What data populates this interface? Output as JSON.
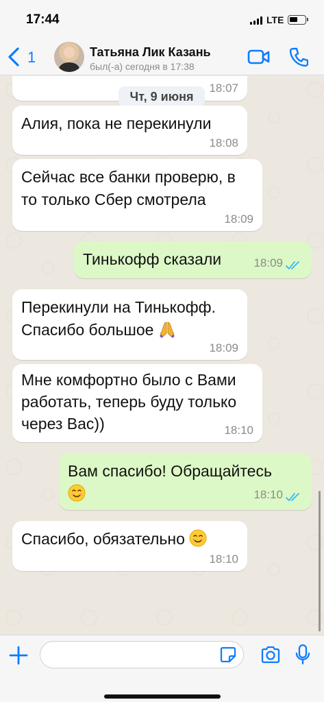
{
  "status_bar": {
    "time": "17:44",
    "network": "LTE"
  },
  "header": {
    "back_count": "1",
    "contact_name": "Татьяна Лик Казань",
    "contact_status": "был(-а) сегодня в 17:38",
    "icons": [
      "chevron-left-icon",
      "video-camera-icon",
      "phone-icon"
    ]
  },
  "chat": {
    "date_label": "Чт, 9 июня",
    "partial_time": "18:07",
    "messages": [
      {
        "direction": "in",
        "lines": [
          "Алия, пока не перекинули"
        ],
        "time": "18:08"
      },
      {
        "direction": "in",
        "lines": [
          "Сейчас все банки проверю, в",
          "то только Сбер смотрела"
        ],
        "time": "18:09"
      },
      {
        "direction": "out",
        "lines": [
          "Тинькофф сказали"
        ],
        "time": "18:09",
        "status": "read"
      },
      {
        "direction": "in",
        "lines": [
          "Перекинули на Тинькофф.",
          "Спасибо большое"
        ],
        "emoji": "🙏",
        "time": "18:09"
      },
      {
        "direction": "in",
        "lines": [
          "Мне комфортно было с Вами",
          "работать, теперь буду только",
          "через Вас))"
        ],
        "time": "18:10"
      },
      {
        "direction": "out",
        "lines": [
          "Вам спасибо! Обращайтесь"
        ],
        "emoji": "☺️",
        "time": "18:10",
        "status": "read"
      },
      {
        "direction": "in",
        "lines": [
          "Спасибо, обязательно"
        ],
        "emoji": "😊",
        "time": "18:10"
      }
    ]
  },
  "input_bar": {
    "message_value": "",
    "icons": [
      "plus-icon",
      "sticker-icon",
      "camera-icon",
      "microphone-icon"
    ]
  },
  "colors": {
    "accent": "#0a7cff",
    "incoming_bubble": "#ffffff",
    "outgoing_bubble": "#dcf8c6",
    "chat_background": "#ece7df",
    "read_check": "#34b7f1"
  }
}
